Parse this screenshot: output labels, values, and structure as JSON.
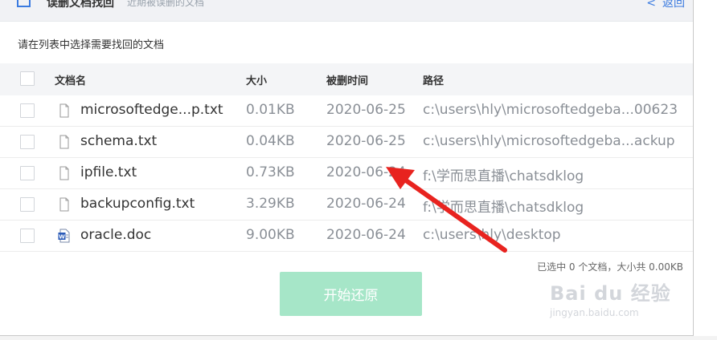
{
  "header": {
    "title": "误删文档找回",
    "subtitle": "近期被误删的文档",
    "back_label": "返回"
  },
  "instruction": "请在列表中选择需要找回的文档",
  "columns": {
    "name": "文档名",
    "size": "大小",
    "time": "被删时间",
    "path": "路径"
  },
  "files": [
    {
      "name": "microsoftedge...p.txt",
      "size": "0.01KB",
      "time": "2020-06-25",
      "path": "c:\\users\\hly\\microsoftedgeba...00623",
      "icon": "txt-file-icon"
    },
    {
      "name": "schema.txt",
      "size": "0.04KB",
      "time": "2020-06-25",
      "path": "c:\\users\\hly\\microsoftedgeba...ackup",
      "icon": "txt-file-icon"
    },
    {
      "name": "ipfile.txt",
      "size": "0.73KB",
      "time": "2020-06-24",
      "path": "f:\\学而思直播\\chatsdklog",
      "icon": "txt-file-icon"
    },
    {
      "name": "backupconfig.txt",
      "size": "3.29KB",
      "time": "2020-06-24",
      "path": "f:\\学而思直播\\chatsdklog",
      "icon": "txt-file-icon"
    },
    {
      "name": "oracle.doc",
      "size": "9.00KB",
      "time": "2020-06-24",
      "path": "c:\\users\\hly\\desktop",
      "icon": "word-doc-icon"
    }
  ],
  "summary": "已选中 0 个文档，大小共 0.00KB",
  "start_button": "开始还原",
  "watermark": {
    "line1": "Bai du 经验",
    "line2": "jingyan.baidu.com"
  },
  "colors": {
    "accent_link": "#3b7be0",
    "start_button": "#a6e6c8",
    "annotation_arrow": "#e8231f",
    "word_icon": "#2b5bb8"
  }
}
